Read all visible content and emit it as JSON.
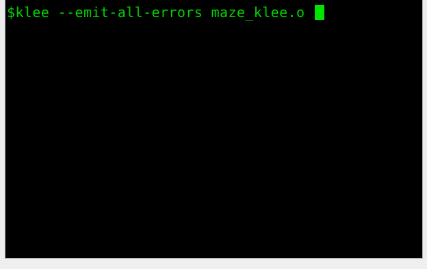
{
  "terminal": {
    "prompt": "$",
    "command": "klee --emit-all-errors maze_klee.o ",
    "text_color": "#00d200",
    "cursor_color": "#00e400",
    "background_color": "#000000"
  }
}
